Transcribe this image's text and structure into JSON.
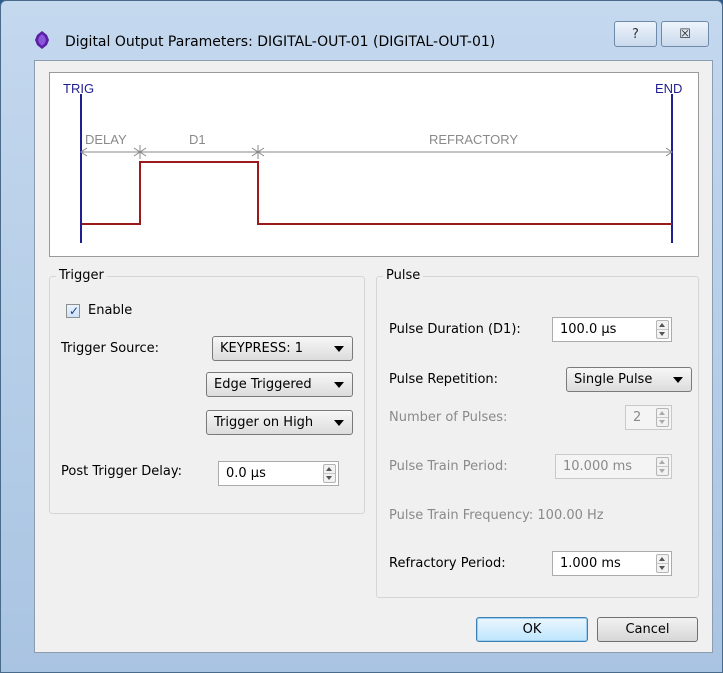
{
  "window": {
    "title": "Digital Output Parameters: DIGITAL-OUT-01 (DIGITAL-OUT-01)",
    "help_label": "?",
    "close_label": "☒"
  },
  "diagram": {
    "trig_label": "TRIG",
    "end_label": "END",
    "delay_label": "DELAY",
    "d1_label": "D1",
    "refractory_label": "REFRACTORY",
    "marker_color": "#1f1f8f",
    "signal_color": "#9b1b1b",
    "dimension_color": "#8a8a8a"
  },
  "trigger": {
    "group_title": "Trigger",
    "enable_label": "Enable",
    "enable_checked": true,
    "enable_check_glyph": "✓",
    "source_label": "Trigger Source:",
    "source_value": "KEYPRESS: 1",
    "edge_value": "Edge Triggered",
    "level_value": "Trigger on High",
    "post_delay_label": "Post Trigger Delay:",
    "post_delay_value": "0.0 µs"
  },
  "pulse": {
    "group_title": "Pulse",
    "duration_label": "Pulse Duration (D1):",
    "duration_value": "100.0 µs",
    "repetition_label": "Pulse Repetition:",
    "repetition_value": "Single Pulse",
    "num_pulses_label": "Number of Pulses:",
    "num_pulses_value": "2",
    "train_period_label": "Pulse Train Period:",
    "train_period_value": "10.000 ms",
    "train_frequency_text": "Pulse Train Frequency: 100.00 Hz",
    "refractory_label": "Refractory Period:",
    "refractory_value": "1.000 ms"
  },
  "buttons": {
    "ok_label": "OK",
    "cancel_label": "Cancel"
  }
}
